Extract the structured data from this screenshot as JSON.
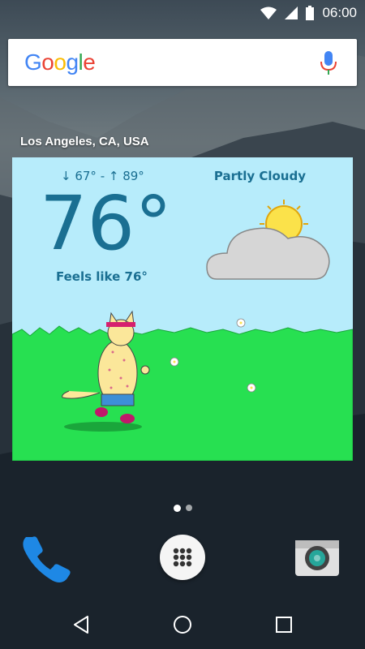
{
  "status_bar": {
    "time": "06:00"
  },
  "search": {
    "logo_text": "Google",
    "logo_colors": [
      "#4285F4",
      "#EA4335",
      "#FBBC05",
      "#4285F4",
      "#34A853",
      "#EA4335"
    ],
    "icon": "mic-icon"
  },
  "weather": {
    "location": "Los Angeles, CA, USA",
    "hi_lo": "↓ 67° - ↑ 89°",
    "temperature": "76°",
    "feels_like": "Feels like  76°",
    "condition": "Partly Cloudy",
    "colors": {
      "sky": "#b7ecfb",
      "text": "#1a6f92",
      "grass": "#27e051"
    }
  },
  "home": {
    "page_count": 2,
    "active_page": 1,
    "dock": [
      "phone-icon",
      "apps-drawer-icon",
      "camera-icon"
    ]
  },
  "nav": {
    "buttons": [
      "back-icon",
      "home-icon",
      "recents-icon"
    ]
  }
}
